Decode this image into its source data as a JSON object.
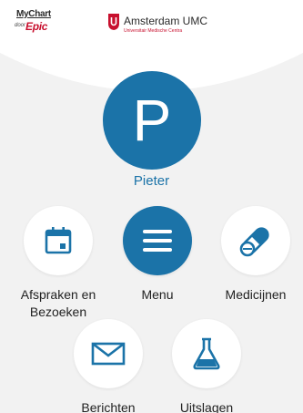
{
  "header": {
    "mychart_name": "MyChart",
    "mychart_door": "door",
    "mychart_epic": "Epic",
    "amc_name": "Amsterdam UMC",
    "amc_subtitle": "Universitair Medische Centra"
  },
  "profile": {
    "initial": "P",
    "name": "Pieter"
  },
  "tiles": [
    {
      "label": "Afspraken en\nBezoeken",
      "icon": "calendar-icon"
    },
    {
      "label": "Menu",
      "icon": "menu-icon"
    },
    {
      "label": "Medicijnen",
      "icon": "pill-icon"
    },
    {
      "label": "Berichten",
      "icon": "envelope-icon"
    },
    {
      "label": "Uitslagen",
      "icon": "flask-icon"
    }
  ],
  "colors": {
    "accent": "#1b73a8",
    "background": "#f2f2f2",
    "epic_red": "#c8102e"
  }
}
